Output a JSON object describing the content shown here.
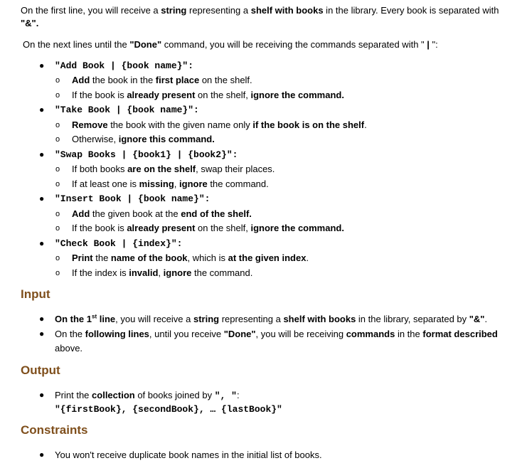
{
  "intro": {
    "l1_a": "On the first line, you will receive a ",
    "l1_b": "string",
    "l1_c": " representing a ",
    "l1_d": "shelf with books",
    "l1_e": " in the library. Every book is separated with",
    "l2": "\"&\".",
    "l3_a": "On the next lines until the ",
    "l3_b": "\"Done\"",
    "l3_c": " command, you will be receiving the commands separated with \" ",
    "l3_d": "|",
    "l3_e": " \":"
  },
  "commands": [
    {
      "syntax": "\"Add Book | {book name}\":",
      "sub1": {
        "a": "Add",
        "b": " the book in the ",
        "c": "first place",
        "d": " on the shelf."
      },
      "sub2": {
        "a": "If the book is ",
        "b": "already present",
        "c": " on the shelf, ",
        "d": "ignore the command."
      }
    },
    {
      "syntax": "\"Take Book | {book name}\":",
      "sub1": {
        "a": "Remove",
        "b": " the book with the given name only ",
        "c": "if the book is on the shelf",
        "d": "."
      },
      "sub2": {
        "a": "Otherwise, ",
        "b": "ignore this command."
      }
    },
    {
      "syntax": "\"Swap Books | {book1} | {book2}\":",
      "sub1": {
        "a": "If both books ",
        "b": "are on the shelf",
        "c": ", swap their places."
      },
      "sub2": {
        "a": "If at least one is ",
        "b": "missing",
        "c": ", ",
        "d": "ignore",
        "e": " the command."
      }
    },
    {
      "syntax": "\"Insert Book | {book name}\":",
      "sub1": {
        "a": "Add",
        "b": " the given book at the ",
        "c": "end of the shelf."
      },
      "sub2": {
        "a": "If the book is ",
        "b": "already present",
        "c": " on the shelf, ",
        "d": "ignore the command."
      }
    },
    {
      "syntax": "\"Check Book | {index}\":",
      "sub1": {
        "a": "Print",
        "b": " the ",
        "c": "name of the book",
        "d": ", which is ",
        "e": "at the given index",
        "f": "."
      },
      "sub2": {
        "a": "If the index is ",
        "b": "invalid",
        "c": ", ",
        "d": "ignore",
        "e": " the command."
      }
    }
  ],
  "input": {
    "heading": "Input",
    "b1": {
      "a": "On the 1",
      "sup": "st",
      "b": " line",
      "c": ", you will receive a ",
      "d": "string",
      "e": " representing a ",
      "f": "shelf with books",
      "g": " in the library, separated by ",
      "h": "\"&\"",
      "i": "."
    },
    "b2": {
      "a": "On the ",
      "b": "following lines",
      "c": ", until you receive ",
      "d": "\"Done\"",
      "e": ", you will be receiving ",
      "f": "commands",
      "g": " in the ",
      "h": "format described",
      "i": "above."
    }
  },
  "output": {
    "heading": "Output",
    "b1": {
      "a": "Print the ",
      "b": "collection",
      "c": " of books joined by ",
      "d": "\", \"",
      "e": ":"
    },
    "format": "\"{firstBook}, {secondBook}, … {lastBook}\""
  },
  "constraints": {
    "heading": "Constraints",
    "b1": "You won't receive duplicate book names in the initial list of books."
  }
}
